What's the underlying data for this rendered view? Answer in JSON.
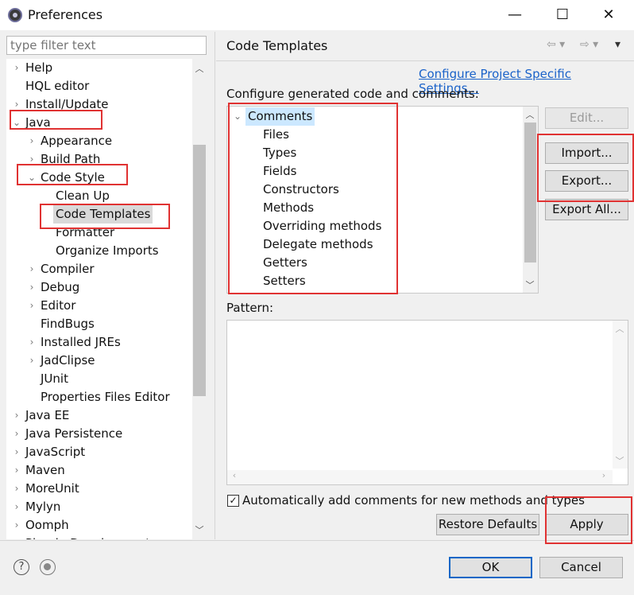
{
  "window": {
    "title": "Preferences",
    "controls": {
      "minimize": "—",
      "maximize": "☐",
      "close": "✕"
    }
  },
  "filter": {
    "placeholder": "type filter text"
  },
  "tree": {
    "items": [
      {
        "label": "Help",
        "level": 0,
        "expander": "collapsed"
      },
      {
        "label": "HQL editor",
        "level": 0,
        "expander": "none"
      },
      {
        "label": "Install/Update",
        "level": 0,
        "expander": "collapsed"
      },
      {
        "label": "Java",
        "level": 0,
        "expander": "expanded"
      },
      {
        "label": "Appearance",
        "level": 1,
        "expander": "collapsed"
      },
      {
        "label": "Build Path",
        "level": 1,
        "expander": "collapsed"
      },
      {
        "label": "Code Style",
        "level": 1,
        "expander": "expanded"
      },
      {
        "label": "Clean Up",
        "level": 2,
        "expander": "none"
      },
      {
        "label": "Code Templates",
        "level": 2,
        "expander": "none",
        "selected": true
      },
      {
        "label": "Formatter",
        "level": 2,
        "expander": "none"
      },
      {
        "label": "Organize Imports",
        "level": 2,
        "expander": "none"
      },
      {
        "label": "Compiler",
        "level": 1,
        "expander": "collapsed"
      },
      {
        "label": "Debug",
        "level": 1,
        "expander": "collapsed"
      },
      {
        "label": "Editor",
        "level": 1,
        "expander": "collapsed"
      },
      {
        "label": "FindBugs",
        "level": 1,
        "expander": "none"
      },
      {
        "label": "Installed JREs",
        "level": 1,
        "expander": "collapsed"
      },
      {
        "label": "JadClipse",
        "level": 1,
        "expander": "collapsed"
      },
      {
        "label": "JUnit",
        "level": 1,
        "expander": "none"
      },
      {
        "label": "Properties Files Editor",
        "level": 1,
        "expander": "none"
      },
      {
        "label": "Java EE",
        "level": 0,
        "expander": "collapsed"
      },
      {
        "label": "Java Persistence",
        "level": 0,
        "expander": "collapsed"
      },
      {
        "label": "JavaScript",
        "level": 0,
        "expander": "collapsed"
      },
      {
        "label": "Maven",
        "level": 0,
        "expander": "collapsed"
      },
      {
        "label": "MoreUnit",
        "level": 0,
        "expander": "collapsed"
      },
      {
        "label": "Mylyn",
        "level": 0,
        "expander": "collapsed"
      },
      {
        "label": "Oomph",
        "level": 0,
        "expander": "collapsed"
      },
      {
        "label": "Plug-in Development",
        "level": 0,
        "expander": "collapsed"
      }
    ]
  },
  "page": {
    "title": "Code Templates",
    "configure_link": "Configure Project Specific Settings...",
    "description": "Configure generated code and comments:",
    "templates": [
      {
        "label": "Comments",
        "level": 0,
        "expander": "expanded",
        "selected": true
      },
      {
        "label": "Files",
        "level": 1
      },
      {
        "label": "Types",
        "level": 1
      },
      {
        "label": "Fields",
        "level": 1
      },
      {
        "label": "Constructors",
        "level": 1
      },
      {
        "label": "Methods",
        "level": 1
      },
      {
        "label": "Overriding methods",
        "level": 1
      },
      {
        "label": "Delegate methods",
        "level": 1
      },
      {
        "label": "Getters",
        "level": 1
      },
      {
        "label": "Setters",
        "level": 1
      }
    ],
    "buttons": {
      "edit": "Edit...",
      "import": "Import...",
      "export": "Export...",
      "export_all": "Export All..."
    },
    "pattern_label": "Pattern:",
    "pattern_value": "",
    "auto_comments": {
      "label": "Automatically add comments for new methods and types",
      "checked": true
    },
    "restore_defaults": "Restore Defaults",
    "apply": "Apply"
  },
  "footer": {
    "ok": "OK",
    "cancel": "Cancel"
  },
  "icons": {
    "help": "help-icon",
    "prefs": "preferences-icon",
    "back": "back-arrow-icon",
    "forward": "forward-arrow-icon"
  },
  "colors": {
    "link": "#1a62c9",
    "annotation": "#e03232",
    "primary_border": "#0b66c6"
  }
}
